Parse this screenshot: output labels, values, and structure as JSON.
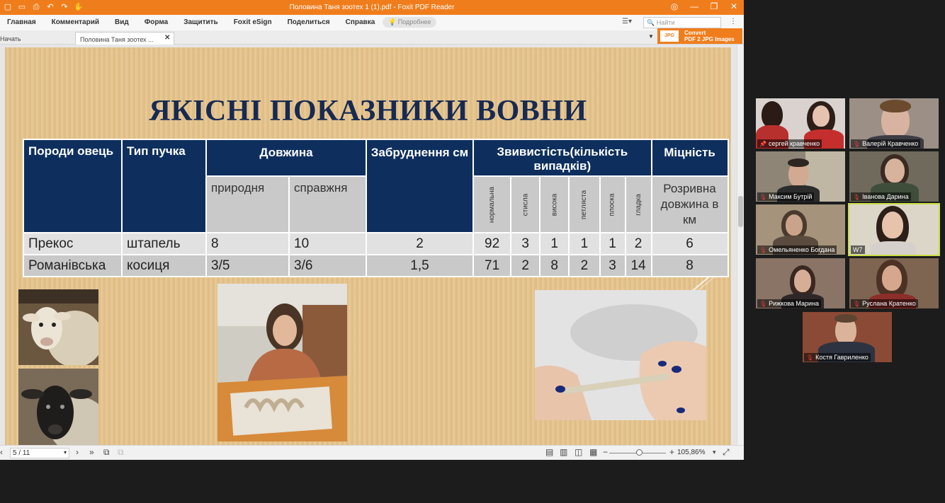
{
  "window": {
    "title": "Половина Таня зоотех 1 (1).pdf - Foxit PDF Reader"
  },
  "menu": {
    "items": [
      "Главная",
      "Комментарий",
      "Вид",
      "Форма",
      "Защитить",
      "Foxit eSign",
      "Поделиться",
      "Справка"
    ],
    "tell_me": "Подробнее",
    "search_placeholder": "Найти"
  },
  "tabs": {
    "start": "Начать",
    "document": "Половина Таня зоотех ..."
  },
  "convert_ad": {
    "line1": "Convert",
    "line2": "PDF 2 JPG Images",
    "icon_text": "JPG"
  },
  "slide": {
    "title": "ЯКІСНІ ПОКАЗНИКИ ВОВНИ",
    "table": {
      "h_breed": "Породи овець",
      "h_type": "Тип пучка",
      "h_length": "Довжина",
      "h_contam": "Забруднення см",
      "h_crimp": "Звивистість(кількість випадків)",
      "h_strength": "Міцність",
      "sub_natural": "природня",
      "sub_true": "справжня",
      "sub_normal": "нормальна",
      "sub_flat": "стисла",
      "sub_high": "висока",
      "sub_loop": "петляста",
      "sub_plain": "плоска",
      "sub_smooth": "гладка",
      "sub_strength": "Розривна довжина в км",
      "rows": [
        {
          "breed": "Прекос",
          "type": "штапель",
          "natural": "8",
          "true": "10",
          "contam": "2",
          "normal": "92",
          "flat": "3",
          "high": "1",
          "loop": "1",
          "plain": "1",
          "smooth": "2",
          "strength": "6"
        },
        {
          "breed": "Романівська",
          "type": "косиця",
          "natural": "3/5",
          "true": "3/6",
          "contam": "1,5",
          "normal": "71",
          "flat": "2",
          "high": "8",
          "loop": "2",
          "plain": "3",
          "smooth": "14",
          "strength": "8"
        }
      ]
    }
  },
  "status": {
    "page": "5 / 11",
    "zoom": "105,86%"
  },
  "participants": [
    "сергей кравченко",
    "Валерій Кравченко",
    "Максим Бутрій",
    "Іванова Дарина",
    "Омельяненко Богдана",
    "W7",
    "Рижкова Марина",
    "Руслана Кратенко",
    "Костя Гавриленко"
  ]
}
